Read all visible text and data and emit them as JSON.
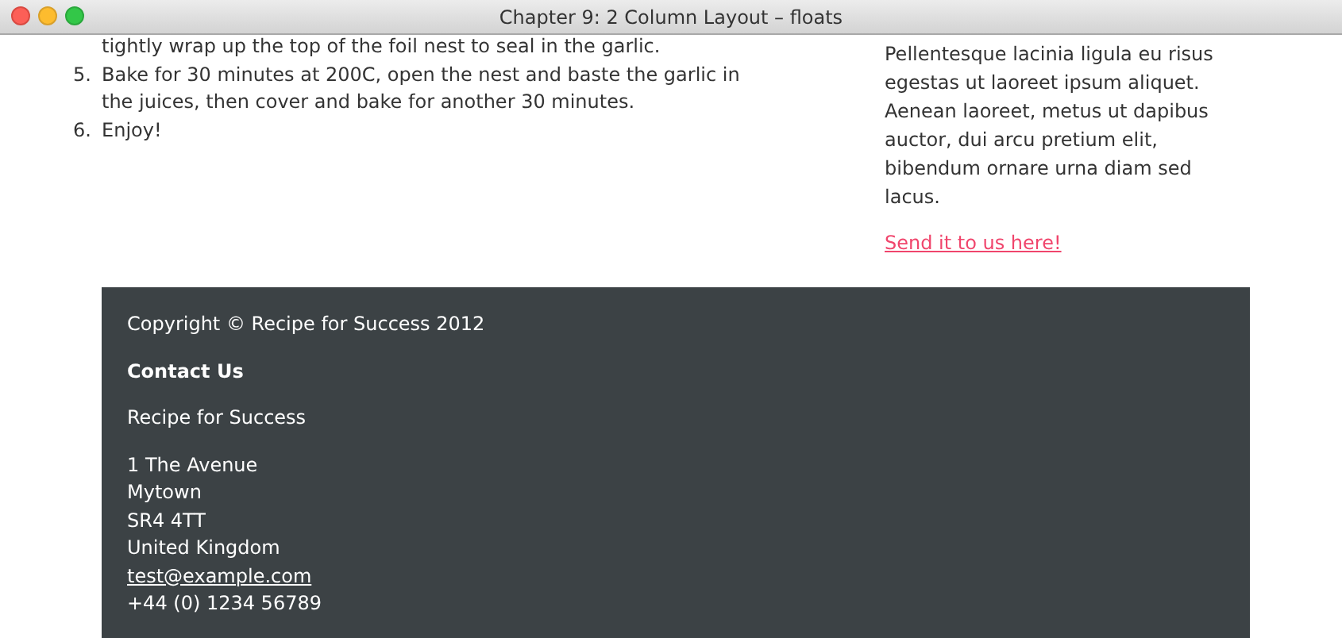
{
  "window": {
    "title": "Chapter 9: 2 Column Layout – floats"
  },
  "method": {
    "steps": [
      {
        "text": "tightly wrap up the top of the foil nest to seal in the garlic."
      },
      {
        "number": "5.",
        "text": "Bake for 30 minutes at 200C, open the nest and baste the garlic in the juices, then cover and bake for another 30 minutes."
      },
      {
        "number": "6.",
        "text": "Enjoy!"
      }
    ]
  },
  "sidebar": {
    "paragraph": "Pellentesque lacinia ligula eu risus egestas ut laoreet ipsum aliquet. Aenean laoreet, metus ut dapibus auctor, dui arcu pretium elit, bibendum ornare urna diam sed lacus.",
    "link": "Send it to us here!"
  },
  "footer": {
    "copyright": "Copyright © Recipe for Success 2012",
    "heading": "Contact Us",
    "company": "Recipe for Success",
    "address": [
      "1 The Avenue",
      "Mytown",
      "SR4 4TT",
      "United Kingdom"
    ],
    "email": "test@example.com",
    "phone": "+44 (0) 1234 56789"
  }
}
